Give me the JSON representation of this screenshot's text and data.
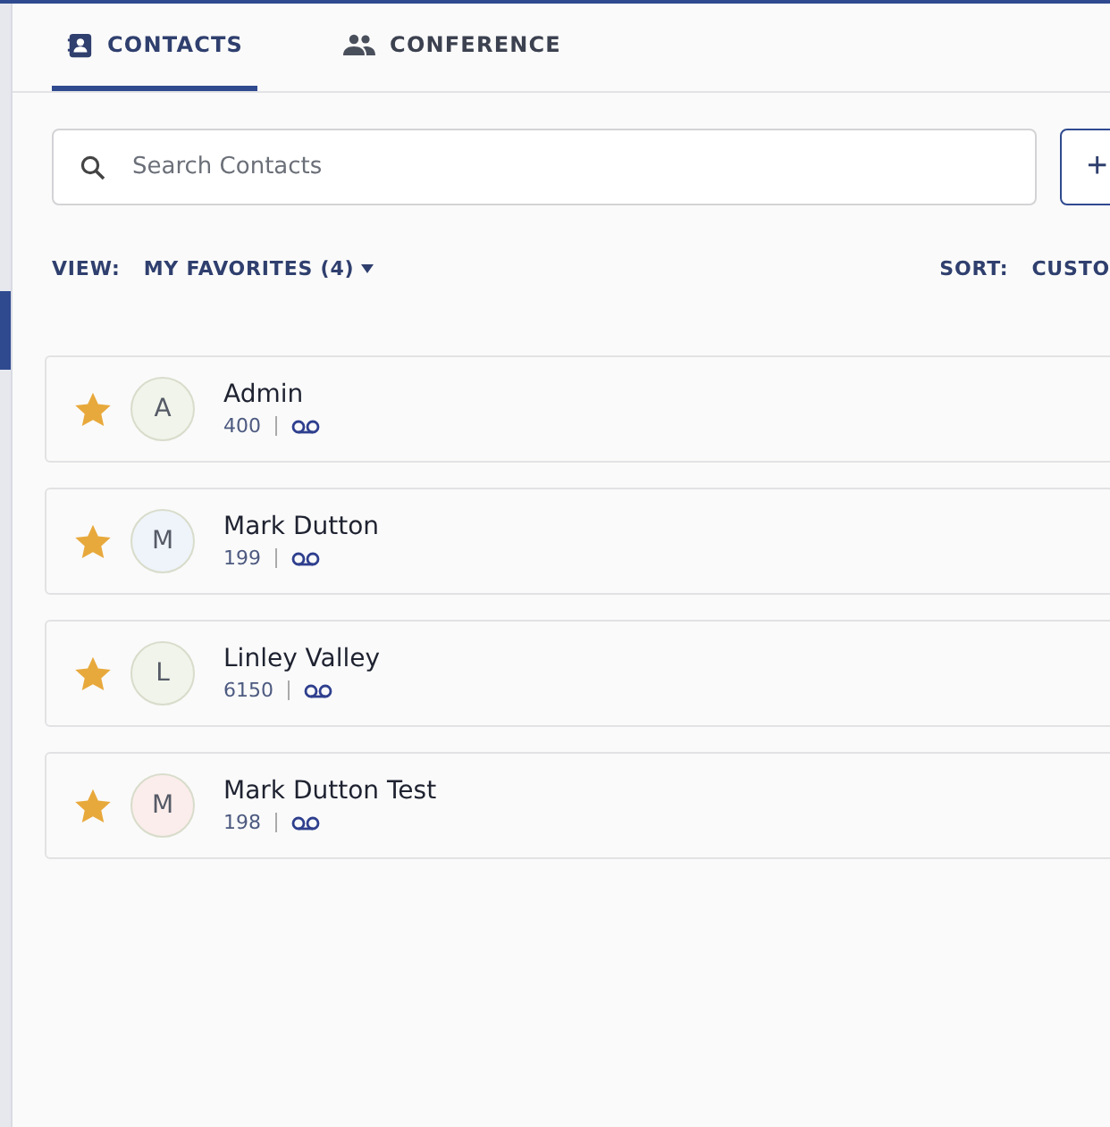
{
  "tabs": [
    {
      "label": "CONTACTS",
      "kind": "contacts",
      "selected": true
    },
    {
      "label": "CONFERENCE",
      "kind": "conference",
      "selected": false
    }
  ],
  "search": {
    "placeholder": "Search Contacts"
  },
  "add_button": "+",
  "view": {
    "label": "VIEW:",
    "value": "MY FAVORITES (4)"
  },
  "sort": {
    "label": "SORT:",
    "value": "CUSTO"
  },
  "contacts": [
    {
      "initial": "A",
      "name": "Admin",
      "extension": "400",
      "favorite": true,
      "color": "#f1f4ea"
    },
    {
      "initial": "M",
      "name": "Mark Dutton",
      "extension": "199",
      "favorite": true,
      "color": "#eef4f9"
    },
    {
      "initial": "L",
      "name": "Linley Valley",
      "extension": "6150",
      "favorite": true,
      "color": "#f1f4ea"
    },
    {
      "initial": "M",
      "name": "Mark Dutton Test",
      "extension": "198",
      "favorite": true,
      "color": "#fbedeb"
    }
  ]
}
